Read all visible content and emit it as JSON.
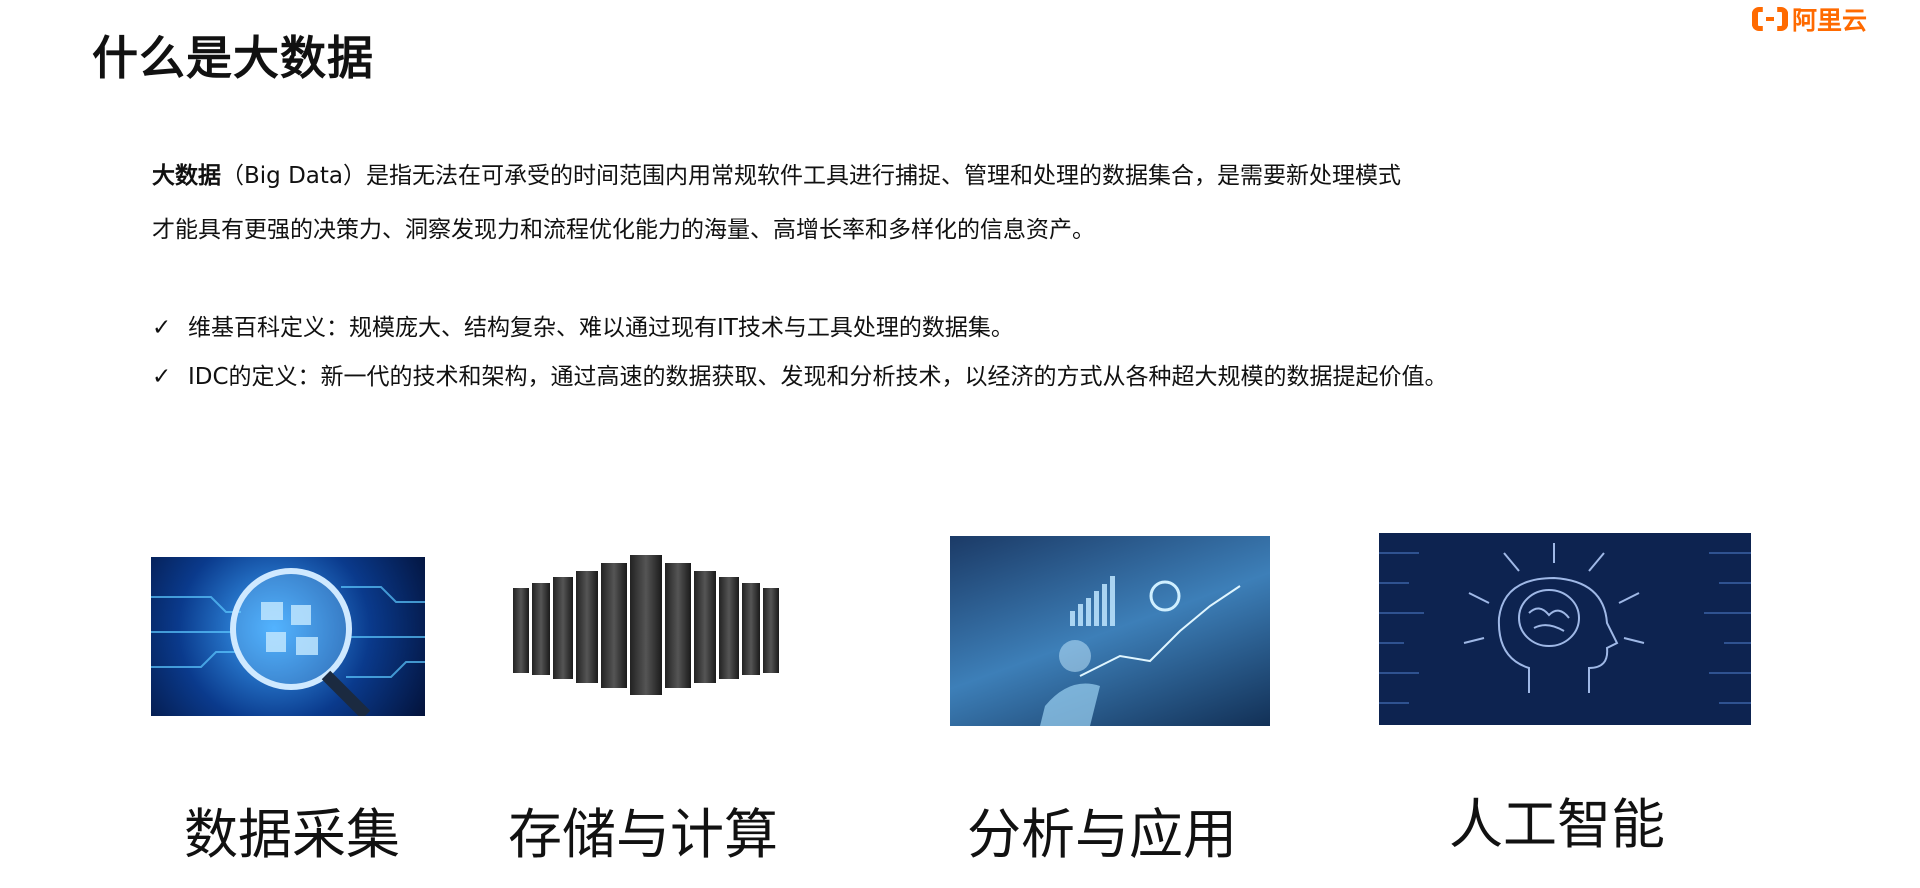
{
  "slide": {
    "title": "什么是大数据",
    "logo_text": "阿里云",
    "brand_color": "#ff6a00",
    "intro": {
      "term": "大数据",
      "line1": "（Big Data）是指无法在可承受的时间范围内用常规软件工具进行捕捉、管理和处理的数据集合，是需要新处理模式",
      "line2": "才能具有更强的决策力、洞察发现力和流程优化能力的海量、高增长率和多样化的信息资产。"
    },
    "bullets": [
      {
        "icon": "check-icon",
        "mark": "✓",
        "text": "维基百科定义：规模庞大、结构复杂、难以通过现有IT技术与工具处理的数据集。"
      },
      {
        "icon": "check-icon",
        "mark": "✓",
        "text": "IDC的定义：新一代的技术和架构，通过高速的数据获取、发现和分析技术，以经济的方式从各种超大规模的数据提起价值。"
      }
    ],
    "captions": [
      "数据采集",
      "存储与计算",
      "分析与应用",
      "人工智能"
    ]
  }
}
